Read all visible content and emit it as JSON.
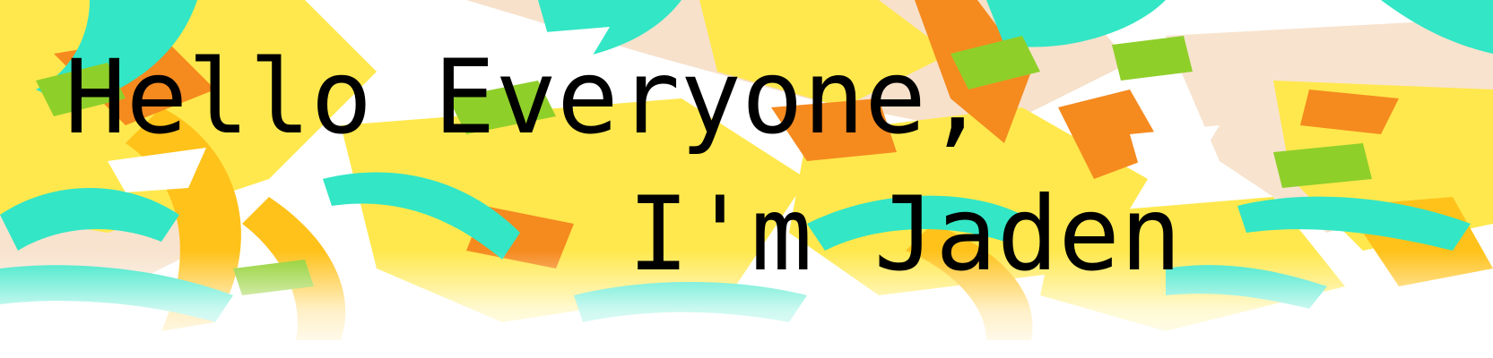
{
  "banner": {
    "headline_line_1": "Hello Everyone,",
    "headline_line_2": "I'm Jaden"
  },
  "colors": {
    "teal": "#33e6c5",
    "yellow": "#ffe84d",
    "amber": "#ffc21a",
    "orange": "#f58a1f",
    "lime": "#8fcf2a",
    "peach": "#f6dcc2",
    "text": "#000000",
    "background": "#ffffff"
  },
  "artwork": {
    "description_free": true,
    "style": "abstract-brush-strokes"
  }
}
